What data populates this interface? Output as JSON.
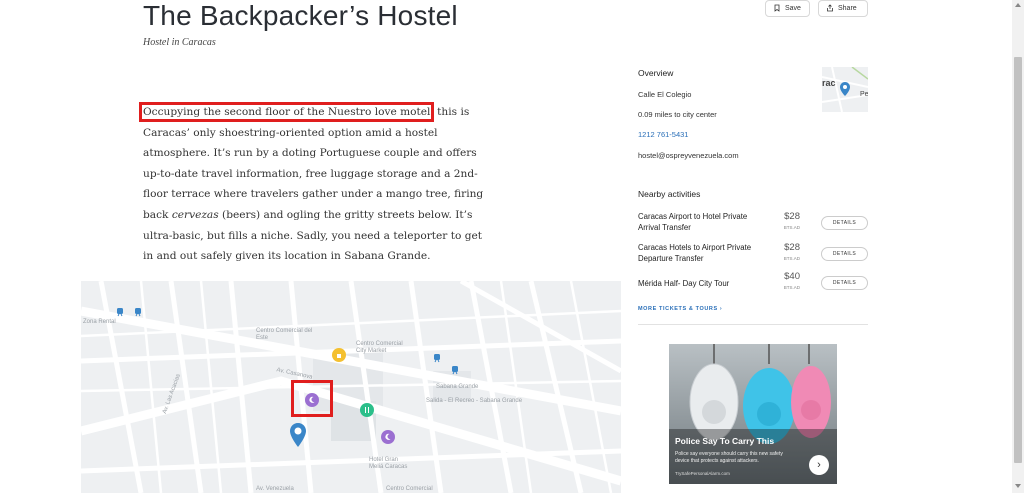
{
  "header": {
    "title": "The Backpacker’s Hostel",
    "subtitle": "Hostel in Caracas",
    "save_label": "Save",
    "share_label": "Share"
  },
  "description": {
    "highlight": "Occupying the second floor of the Nuestro love motel",
    "part1": ", this is Caracas’ only shoestring-oriented option amid a hostel atmosphere. It’s run by a doting Portuguese couple and offers up-to-date travel information, free luggage storage and a 2nd-floor terrace where travelers gather under a mango tree, firing back ",
    "em": "cervezas",
    "part2": " (beers) and ogling the gritty streets below. It’s ultra-basic, but fills a niche. Sadly, you need a teleporter to get in and out safely given its location in Sabana Grande."
  },
  "map": {
    "labels": {
      "zona_rental": "Zona Rental",
      "centro_comercial": "Centro Comercial del Este",
      "city_market": "Centro Comercial City Market",
      "sabana_grande": "Sabana Grande",
      "sabana_grande_stop": "Sabana Grande",
      "hotel": "Hotel Gran Meliá Caracas",
      "av_venezuela": "Av. Venezuela",
      "centro_comercial_bottom": "Centro Comercial",
      "av_casanova": "Av. Casanova",
      "av_las_acacias": "Av. Las Acacias",
      "salida": "Salida - El Recreo - Sabana Grande"
    }
  },
  "overview": {
    "title": "Overview",
    "address": "Calle El Colegio",
    "distance": "0.09 miles to city center",
    "phone": "1212 761-5431",
    "email": "hostel@ospreyvenezuela.com",
    "mini_map_label": "rac",
    "mini_map_label2": "Pe"
  },
  "nearby": {
    "title": "Nearby activities",
    "items": [
      {
        "name": "Caracas Airport to Hotel Private Arrival Transfer",
        "price": "$28",
        "sub": "BTS.AD",
        "button": "DETAILS"
      },
      {
        "name": "Caracas Hotels to Airport Private Departure Transfer",
        "price": "$28",
        "sub": "BTS.AD",
        "button": "DETAILS"
      },
      {
        "name": "Mérida Half- Day City Tour",
        "price": "$40",
        "sub": "BTS.AD",
        "button": "DETAILS"
      }
    ],
    "more_label": "MORE TICKETS & TOURS",
    "more_arrow": "›"
  },
  "ad": {
    "headline": "Police Say To Carry This",
    "body": "Police say everyone should carry this new safety device that protects against attackers.",
    "source": "TrySafePersonalAlarm.com",
    "arrow": "›"
  },
  "colors": {
    "highlight_red": "#e01e1e",
    "link_blue": "#2a6fb8",
    "map_pin_blue": "#3a86c8",
    "map_pin_purple": "#9b6fd1",
    "map_pin_green": "#2bbf8a",
    "map_pin_yellow": "#f4c030"
  }
}
